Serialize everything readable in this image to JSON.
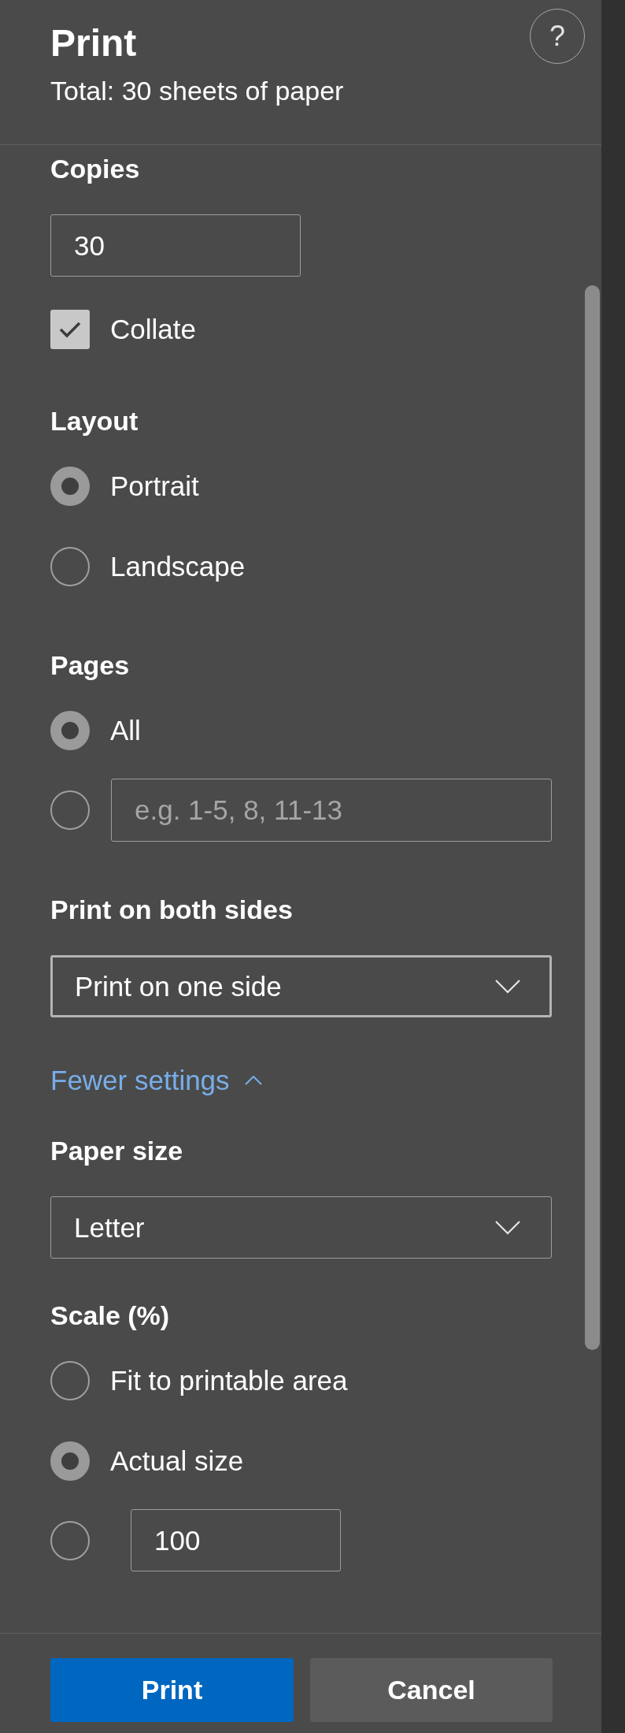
{
  "header": {
    "title": "Print",
    "subtitle": "Total: 30 sheets of paper",
    "help": "?"
  },
  "copies": {
    "label": "Copies",
    "value": "30",
    "collate": {
      "label": "Collate",
      "checked": true
    }
  },
  "layout": {
    "label": "Layout",
    "options": [
      {
        "label": "Portrait",
        "selected": true
      },
      {
        "label": "Landscape",
        "selected": false
      }
    ]
  },
  "pages": {
    "label": "Pages",
    "options": [
      {
        "kind": "text",
        "label": "All",
        "selected": true
      },
      {
        "kind": "field",
        "placeholder": "e.g. 1-5, 8, 11-13",
        "selected": false
      }
    ]
  },
  "duplex": {
    "label": "Print on both sides",
    "value": "Print on one side",
    "focused": true
  },
  "settings_toggle": {
    "label": "Fewer settings",
    "expanded": true
  },
  "paper_size": {
    "label": "Paper size",
    "value": "Letter",
    "focused": false
  },
  "scale": {
    "label": "Scale (%)",
    "options": [
      {
        "kind": "text",
        "label": "Fit to printable area",
        "selected": false
      },
      {
        "kind": "text",
        "label": "Actual size",
        "selected": true
      },
      {
        "kind": "field",
        "value": "100",
        "selected": false
      }
    ]
  },
  "buttons": [
    {
      "label": "Print",
      "kind": "primary"
    },
    {
      "label": "Cancel",
      "kind": "secondary"
    }
  ]
}
